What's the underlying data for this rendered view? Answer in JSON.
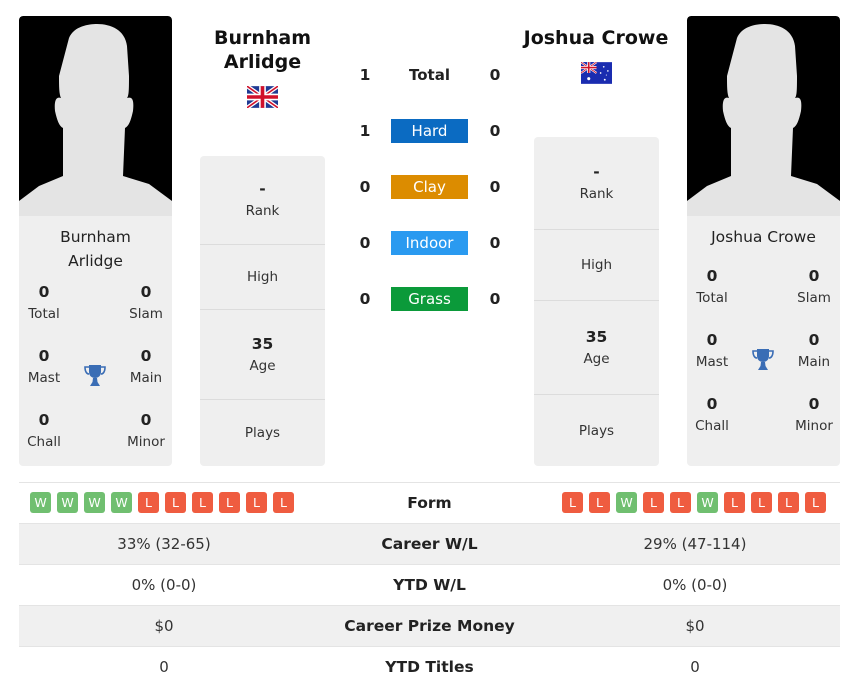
{
  "player1": {
    "name": "Burnham Arlidge",
    "name_line1": "Burnham",
    "name_line2": "Arlidge",
    "flag": "uk-flag",
    "titles": {
      "total": {
        "value": "0",
        "label": "Total"
      },
      "slam": {
        "value": "0",
        "label": "Slam"
      },
      "mast": {
        "value": "0",
        "label": "Mast"
      },
      "main": {
        "value": "0",
        "label": "Main"
      },
      "chall": {
        "value": "0",
        "label": "Chall"
      },
      "minor": {
        "value": "0",
        "label": "Minor"
      }
    },
    "rank": {
      "value": "-",
      "label": "Rank"
    },
    "high": {
      "value": "",
      "label": "High"
    },
    "age": {
      "value": "35",
      "label": "Age"
    },
    "plays": {
      "value": "",
      "label": "Plays"
    },
    "form": [
      "W",
      "W",
      "W",
      "W",
      "L",
      "L",
      "L",
      "L",
      "L",
      "L"
    ],
    "career_wl": "33% (32-65)",
    "ytd_wl": "0% (0-0)",
    "career_prize": "$0",
    "ytd_titles": "0"
  },
  "player2": {
    "name": "Joshua Crowe",
    "flag": "australia-flag",
    "titles": {
      "total": {
        "value": "0",
        "label": "Total"
      },
      "slam": {
        "value": "0",
        "label": "Slam"
      },
      "mast": {
        "value": "0",
        "label": "Mast"
      },
      "main": {
        "value": "0",
        "label": "Main"
      },
      "chall": {
        "value": "0",
        "label": "Chall"
      },
      "minor": {
        "value": "0",
        "label": "Minor"
      }
    },
    "rank": {
      "value": "-",
      "label": "Rank"
    },
    "high": {
      "value": "",
      "label": "High"
    },
    "age": {
      "value": "35",
      "label": "Age"
    },
    "plays": {
      "value": "",
      "label": "Plays"
    },
    "form": [
      "L",
      "L",
      "W",
      "L",
      "L",
      "W",
      "L",
      "L",
      "L",
      "L"
    ],
    "career_wl": "29% (47-114)",
    "ytd_wl": "0% (0-0)",
    "career_prize": "$0",
    "ytd_titles": "0"
  },
  "h2h": [
    {
      "label": "Total",
      "p1": "1",
      "p2": "0",
      "color": ""
    },
    {
      "label": "Hard",
      "p1": "1",
      "p2": "0",
      "color": "#0b6bc2"
    },
    {
      "label": "Clay",
      "p1": "0",
      "p2": "0",
      "color": "#dc8c00"
    },
    {
      "label": "Indoor",
      "p1": "0",
      "p2": "0",
      "color": "#2a9af0"
    },
    {
      "label": "Grass",
      "p1": "0",
      "p2": "0",
      "color": "#0b9a3a"
    }
  ],
  "comparison": {
    "form": "Form",
    "career_wl": "Career W/L",
    "ytd_wl": "YTD W/L",
    "career_prize": "Career Prize Money",
    "ytd_titles": "YTD Titles"
  },
  "colors": {
    "win": "#70bf70",
    "loss": "#ef5c40",
    "trophy": "#3a6db5"
  }
}
